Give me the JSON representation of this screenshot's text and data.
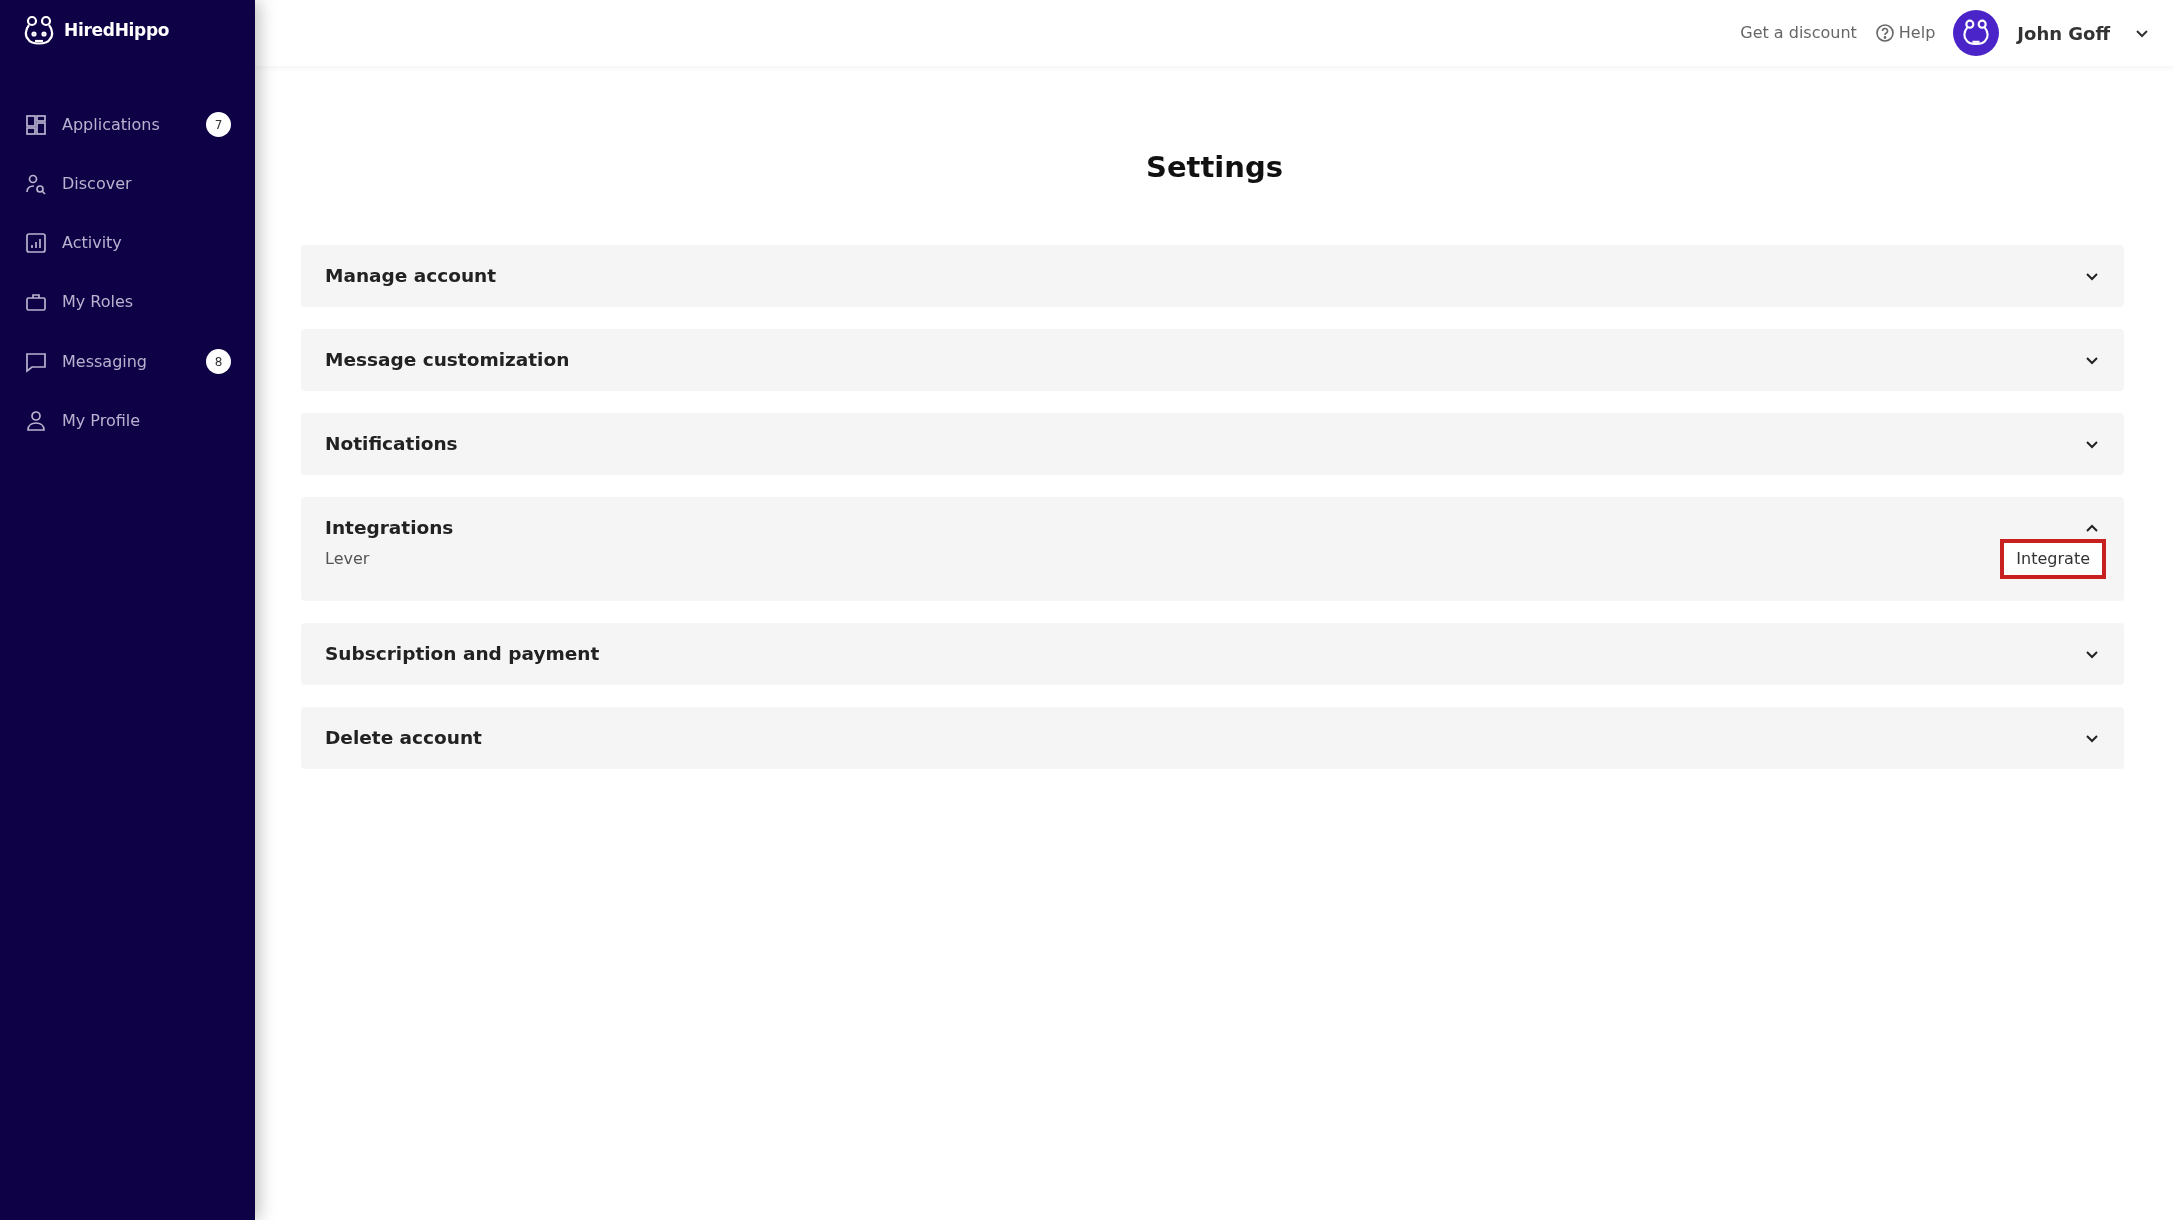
{
  "brand": "HiredHippo",
  "sidebar": {
    "items": [
      {
        "label": "Applications",
        "badge": "7",
        "selected": false
      },
      {
        "label": "Discover",
        "selected": false
      },
      {
        "label": "Activity",
        "selected": false
      },
      {
        "label": "My Roles",
        "selected": false
      },
      {
        "label": "Messaging",
        "badge": "8",
        "selected": false
      },
      {
        "label": "My Profile",
        "selected": false
      }
    ]
  },
  "header": {
    "discount_link": "Get a discount",
    "help_link": "Help",
    "user_name": "John Goff"
  },
  "page_title": "Settings",
  "sections": [
    {
      "title": "Manage account",
      "expanded": false
    },
    {
      "title": "Message customization",
      "expanded": false
    },
    {
      "title": "Notifications",
      "expanded": false
    },
    {
      "title": "Integrations",
      "expanded": true,
      "items": [
        {
          "label": "Lever",
          "action": "Integrate",
          "highlighted": true
        }
      ]
    },
    {
      "title": "Subscription and payment",
      "expanded": false
    },
    {
      "title": "Delete account",
      "expanded": false
    }
  ]
}
